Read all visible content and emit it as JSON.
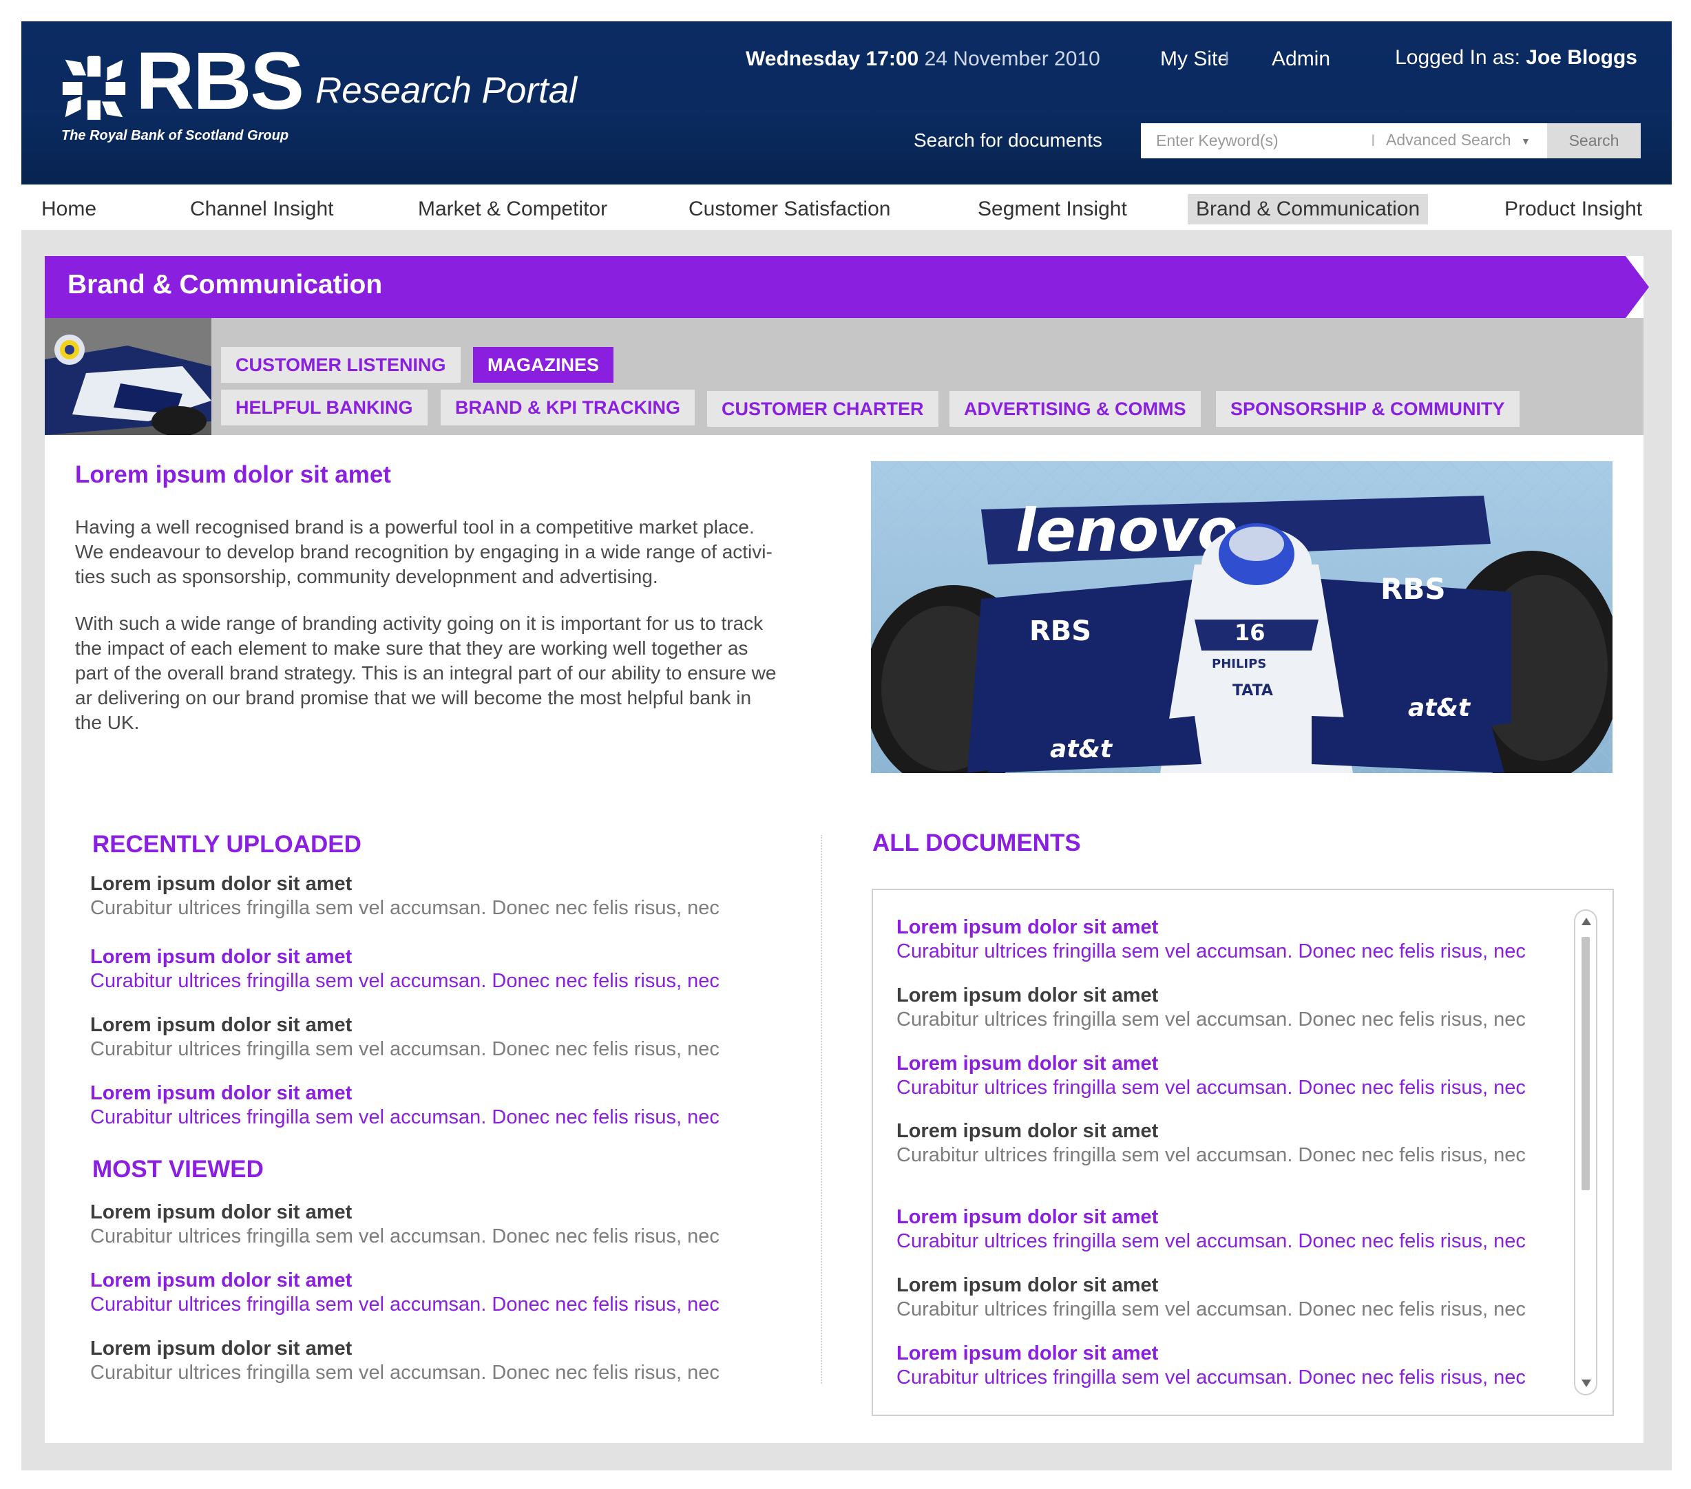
{
  "brand": {
    "logo_word": "RBS",
    "logo_tagline": "The Royal Bank of Scotland Group",
    "portal_title": "Research Portal"
  },
  "header": {
    "day_time": "Wednesday 17:00",
    "date": "24 November 2010",
    "my_site": "My Site",
    "separator": "I",
    "admin": "Admin",
    "logged_in_label": "Logged In as:",
    "user_name": "Joe Bloggs",
    "search_label": "Search for documents",
    "search_placeholder": "Enter Keyword(s)",
    "advanced_search": "Advanced Search",
    "search_button": "Search"
  },
  "nav": {
    "items": [
      {
        "label": "Home"
      },
      {
        "label": "Channel Insight"
      },
      {
        "label": "Market & Competitor"
      },
      {
        "label": "Customer Satisfaction"
      },
      {
        "label": "Segment Insight"
      },
      {
        "label": "Brand & Communication"
      },
      {
        "label": "Product Insight"
      }
    ],
    "active": "Brand & Communication"
  },
  "section": {
    "title": "Brand & Communication",
    "tabs": [
      {
        "label": "CUSTOMER LISTENING"
      },
      {
        "label": "MAGAZINES"
      },
      {
        "label": "HELPFUL BANKING"
      },
      {
        "label": "BRAND & KPI TRACKING"
      },
      {
        "label": "CUSTOMER CHARTER"
      },
      {
        "label": "ADVERTISING & COMMS"
      },
      {
        "label": "SPONSORSHIP & COMMUNITY"
      }
    ],
    "active_tab": "MAGAZINES"
  },
  "intro": {
    "title": "Lorem ipsum dolor sit amet",
    "paragraph1_lines": [
      "Having a well recognised brand is a powerful tool in a competitive market place.",
      "We endeavour to develop brand recognition by engaging in a wide range of activi-",
      "ties such as sponsorship, community developnment and advertising."
    ],
    "paragraph2_lines": [
      "With such a wide range of branding activity going on it is important for us to track",
      "the impact of each element to make sure that they are working well together as",
      "part of the overall brand strategy. This is an integral part of our ability to ensure we",
      "ar delivering on our brand promise that we will become the most helpful bank in",
      "the UK."
    ]
  },
  "recently_uploaded": {
    "heading": "RECENTLY UPLOADED",
    "items": [
      {
        "title": "Lorem ipsum dolor sit amet",
        "summary": "Curabitur ultrices fringilla sem vel accumsan. Donec nec felis risus, nec",
        "style": "gray"
      },
      {
        "title": "Lorem ipsum dolor sit amet",
        "summary": "Curabitur ultrices fringilla sem vel accumsan. Donec nec felis risus, nec",
        "style": "purple"
      },
      {
        "title": "Lorem ipsum dolor sit amet",
        "summary": "Curabitur ultrices fringilla sem vel accumsan. Donec nec felis risus, nec",
        "style": "gray"
      },
      {
        "title": "Lorem ipsum dolor sit amet",
        "summary": "Curabitur ultrices fringilla sem vel accumsan. Donec nec felis risus, nec",
        "style": "purple"
      }
    ]
  },
  "most_viewed": {
    "heading": "MOST VIEWED",
    "items": [
      {
        "title": "Lorem ipsum dolor sit amet",
        "summary": "Curabitur ultrices fringilla sem vel accumsan. Donec nec felis risus, nec",
        "style": "gray"
      },
      {
        "title": "Lorem ipsum dolor sit amet",
        "summary": "Curabitur ultrices fringilla sem vel accumsan. Donec nec felis risus, nec",
        "style": "purple"
      },
      {
        "title": "Lorem ipsum dolor sit amet",
        "summary": "Curabitur ultrices fringilla sem vel accumsan. Donec nec felis risus, nec",
        "style": "gray"
      }
    ]
  },
  "all_documents": {
    "heading": "ALL DOCUMENTS",
    "items": [
      {
        "title": "Lorem ipsum dolor sit amet",
        "summary": "Curabitur ultrices fringilla sem vel accumsan. Donec nec felis risus, nec",
        "style": "purple"
      },
      {
        "title": "Lorem ipsum dolor sit amet",
        "summary": "Curabitur ultrices fringilla sem vel accumsan. Donec nec felis risus, nec",
        "style": "gray"
      },
      {
        "title": "Lorem ipsum dolor sit amet",
        "summary": "Curabitur ultrices fringilla sem vel accumsan. Donec nec felis risus, nec",
        "style": "purple"
      },
      {
        "title": "Lorem ipsum dolor sit amet",
        "summary": "Curabitur ultrices fringilla sem vel accumsan. Donec nec felis risus, nec",
        "style": "gray"
      },
      {
        "title": "Lorem ipsum dolor sit amet",
        "summary": "Curabitur ultrices fringilla sem vel accumsan. Donec nec felis risus, nec",
        "style": "purple"
      },
      {
        "title": "Lorem ipsum dolor sit amet",
        "summary": "Curabitur ultrices fringilla sem vel accumsan. Donec nec felis risus, nec",
        "style": "gray"
      },
      {
        "title": "Lorem ipsum dolor sit amet",
        "summary": "Curabitur ultrices fringilla sem vel accumsan. Donec nec felis risus, nec",
        "style": "purple"
      }
    ]
  },
  "hero_image": {
    "car_number": "16",
    "sponsor_rbs": "RBS",
    "sponsor_lenovo": "lenovo",
    "sponsor_att": "at&t",
    "sponsor_tata": "TATA",
    "sponsor_philips": "PHILIPS"
  },
  "icons": {
    "logo_mark": "rbs-daisy-wheel-icon",
    "advanced_caret": "chevron-down-icon",
    "scroll_up": "arrow-up-icon",
    "scroll_down": "arrow-down-icon"
  },
  "colors": {
    "header_bg": "#0a2a60",
    "accent_purple": "#8a1fe0",
    "frame_gray": "#e2e2e2",
    "subnav_gray": "#c6c6c6",
    "active_nav_bg": "#dcdcdc"
  }
}
